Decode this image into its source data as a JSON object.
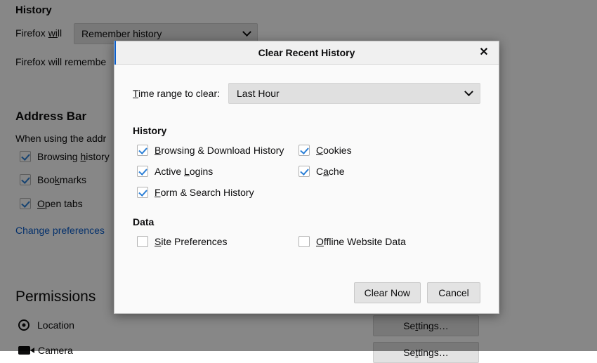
{
  "background": {
    "history_heading": "History",
    "firefox_will_label": "Firefox will",
    "firefox_will_label_prefix": "Firefox ",
    "firefox_will_label_accesskey": "wi",
    "firefox_will_label_suffix": "ll",
    "history_mode_value": "Remember history",
    "history_description": "Firefox will remembe",
    "addressbar_heading": "Address Bar",
    "addressbar_description": "When using the addr",
    "addressbar_items": [
      {
        "label_pre": "Browsing ",
        "label_ak": "h",
        "label_post": "istory",
        "checked": true
      },
      {
        "label_pre": "Boo",
        "label_ak": "k",
        "label_post": "marks",
        "checked": true
      },
      {
        "label_pre": "",
        "label_ak": "O",
        "label_post": "pen tabs",
        "checked": true
      }
    ],
    "change_preferences_link": "Change preferences",
    "permissions_heading": "Permissions",
    "permission_items": [
      {
        "label": "Location",
        "icon": "location-target-icon"
      },
      {
        "label": "Camera",
        "icon": "camera-icon"
      }
    ],
    "settings_buttons": [
      {
        "label_pre": "Se",
        "label_ak": "t",
        "label_post": "tings…"
      },
      {
        "label_pre": "Se",
        "label_ak": "t",
        "label_post": "tings…"
      }
    ]
  },
  "dialog": {
    "title": "Clear Recent History",
    "close_label": "✕",
    "timerange": {
      "label_ak": "T",
      "label_rest": "ime range to clear:",
      "value": "Last Hour"
    },
    "history_section": {
      "title": "History",
      "items": [
        {
          "ak": "B",
          "pre": "",
          "post": "rowsing & Download History",
          "checked": true,
          "col": "left"
        },
        {
          "ak": "C",
          "pre": "",
          "post": "ookies",
          "checked": true,
          "col": "right"
        },
        {
          "ak": "L",
          "pre": "Active ",
          "post": "ogins",
          "checked": true,
          "col": "left"
        },
        {
          "ak": "a",
          "pre": "C",
          "post": "che",
          "checked": true,
          "col": "right"
        },
        {
          "ak": "F",
          "pre": "",
          "post": "orm & Search History",
          "checked": true,
          "col": "left"
        }
      ]
    },
    "data_section": {
      "title": "Data",
      "items": [
        {
          "ak": "S",
          "pre": "",
          "post": "ite Preferences",
          "checked": false,
          "col": "left"
        },
        {
          "ak": "O",
          "pre": "",
          "post": "ffline Website Data",
          "checked": false,
          "col": "right"
        }
      ]
    },
    "buttons": {
      "clear_now": "Clear Now",
      "cancel": "Cancel"
    }
  },
  "colors": {
    "accent_blue": "#0a5ecc",
    "check_blue": "#2b7fd6",
    "dialog_bg": "#fafafa",
    "header_bg": "#f0f0f0",
    "overlay": "rgba(0,0,0,0.47)"
  }
}
